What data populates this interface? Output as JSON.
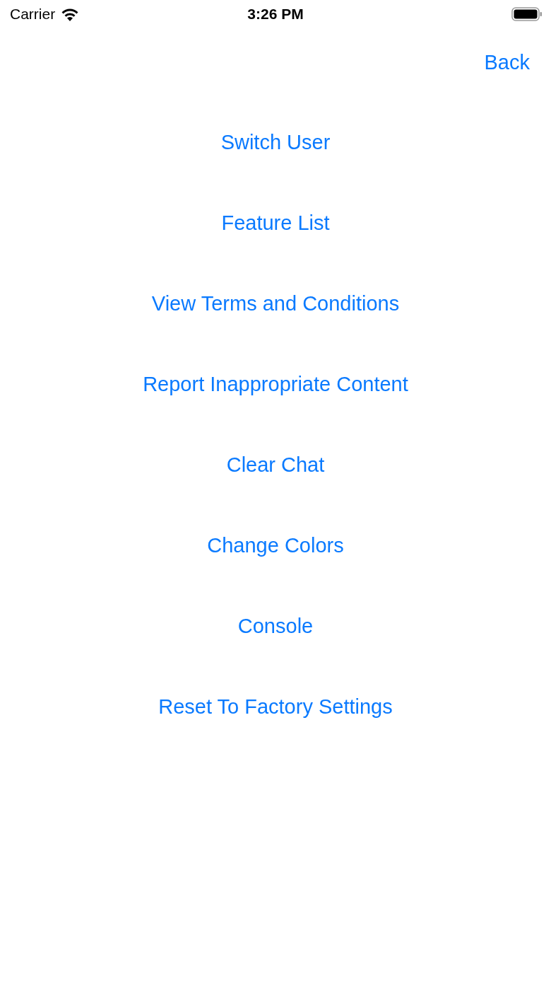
{
  "status_bar": {
    "carrier": "Carrier",
    "time": "3:26 PM"
  },
  "nav": {
    "back": "Back"
  },
  "menu": [
    {
      "label": "Switch User"
    },
    {
      "label": "Feature List"
    },
    {
      "label": "View Terms and Conditions"
    },
    {
      "label": "Report Inappropriate Content"
    },
    {
      "label": "Clear Chat"
    },
    {
      "label": "Change Colors"
    },
    {
      "label": "Console"
    },
    {
      "label": "Reset To Factory Settings"
    }
  ]
}
